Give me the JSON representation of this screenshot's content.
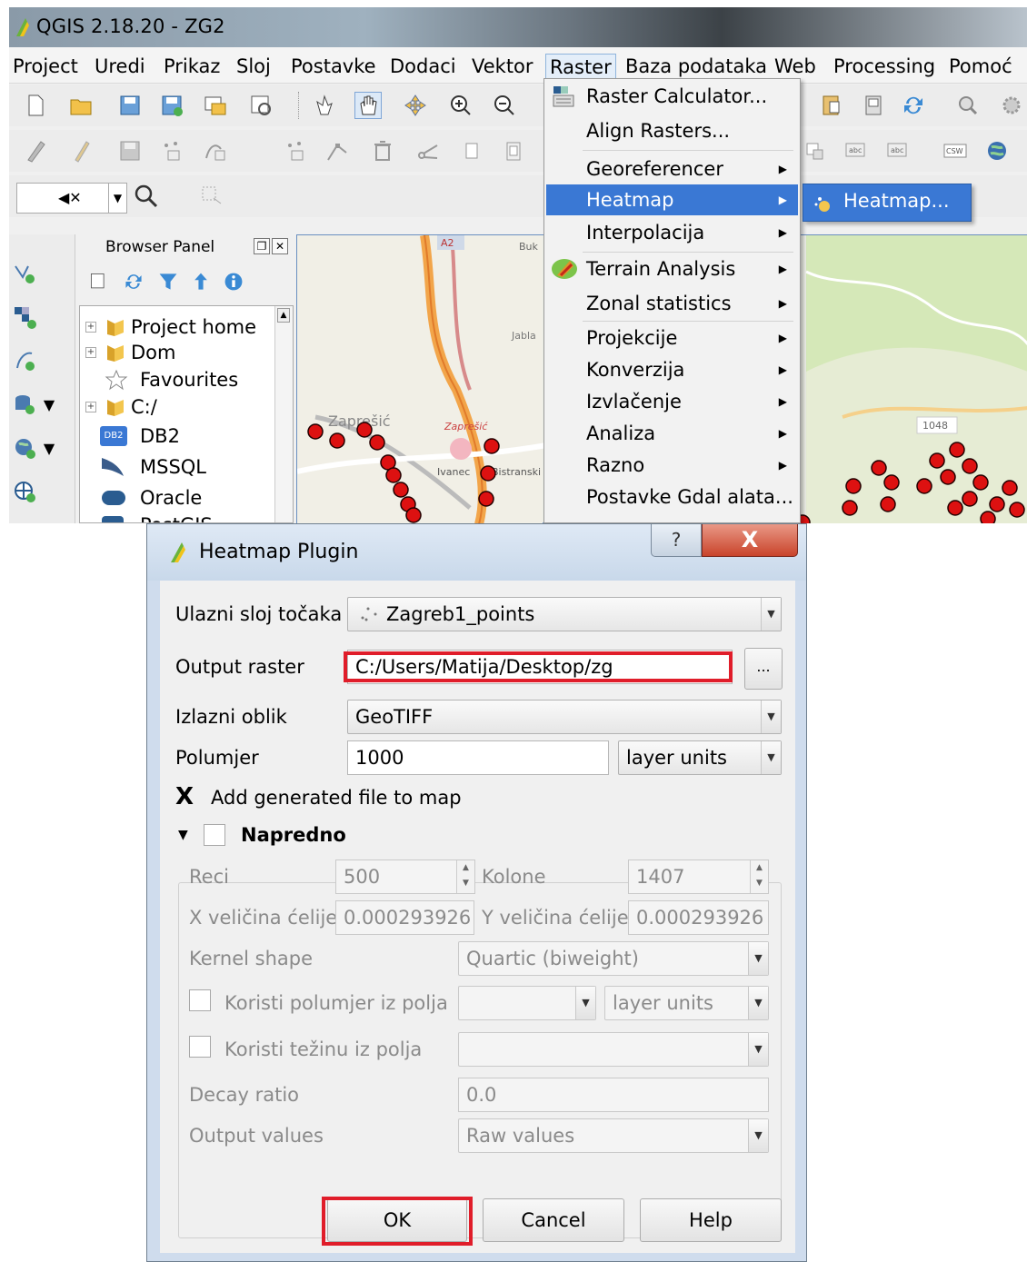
{
  "window": {
    "title": "QGIS 2.18.20 - ZG2"
  },
  "menubar": {
    "items": [
      "Project",
      "Uredi",
      "Prikaz",
      "Sloj",
      "Postavke",
      "Dodaci",
      "Vektor",
      "Raster",
      "Baza podataka",
      "Web",
      "Processing",
      "Pomoć"
    ],
    "active": "Raster"
  },
  "raster_menu": {
    "items": [
      {
        "label": "Raster Calculator...",
        "submenu": false
      },
      {
        "label": "Align Rasters...",
        "submenu": false
      },
      {
        "label": "Georeferencer",
        "submenu": true
      },
      {
        "label": "Heatmap",
        "submenu": true
      },
      {
        "label": "Interpolacija",
        "submenu": true
      },
      {
        "label": "Terrain Analysis",
        "submenu": true
      },
      {
        "label": "Zonal statistics",
        "submenu": true
      },
      {
        "label": "Projekcije",
        "submenu": true
      },
      {
        "label": "Konverzija",
        "submenu": true
      },
      {
        "label": "Izvlačenje",
        "submenu": true
      },
      {
        "label": "Analiza",
        "submenu": true
      },
      {
        "label": "Razno",
        "submenu": true
      },
      {
        "label": "Postavke Gdal alata...",
        "submenu": false
      }
    ]
  },
  "heatmap_submenu": {
    "item": "Heatmap..."
  },
  "browser": {
    "title": "Browser Panel",
    "items": [
      "Project home",
      "Dom",
      "Favourites",
      "C:/",
      "DB2",
      "MSSQL",
      "Oracle",
      "PostGIS"
    ],
    "db2_badge": "DB2"
  },
  "map": {
    "labels": [
      "A2",
      "Buk",
      "Jabla",
      "Zaprešić",
      "Zaprešić",
      "Ivanec",
      "Bistranski",
      "1048"
    ]
  },
  "dialog": {
    "title": "Heatmap Plugin",
    "help_label": "?",
    "close_label": "X",
    "input_layer": {
      "label": "Ulazni sloj točaka",
      "value": "Zagreb1_points"
    },
    "output_raster": {
      "label": "Output raster",
      "value": "C:/Users/Matija/Desktop/zg",
      "browse": "..."
    },
    "output_format": {
      "label": "Izlazni oblik",
      "value": "GeoTIFF"
    },
    "radius": {
      "label": "Polumjer",
      "value": "1000",
      "unit": "layer units"
    },
    "add_to_map": {
      "label": "Add generated file to map",
      "checked": true,
      "mark": "X"
    },
    "advanced": {
      "label": "Napredno",
      "rows_label": "Reci",
      "rows_value": "500",
      "cols_label": "Kolone",
      "cols_value": "1407",
      "cell_x_label": "X veličina ćelije",
      "cell_x_value": "0.000293926",
      "cell_y_label": "Y veličina ćelije",
      "cell_y_value": "0.000293926",
      "kernel_label": "Kernel shape",
      "kernel_value": "Quartic (biweight)",
      "radius_field_label": "Koristi polumjer iz polja",
      "radius_field_unit": "layer units",
      "weight_field_label": "Koristi težinu iz polja",
      "decay_label": "Decay ratio",
      "decay_value": "0.0",
      "output_values_label": "Output values",
      "output_values_value": "Raw values"
    },
    "buttons": {
      "ok": "OK",
      "cancel": "Cancel",
      "help": "Help"
    }
  },
  "colors": {
    "highlight": "#3a78d4",
    "annotation_red": "#e01d2a",
    "map_point": "#d11"
  }
}
